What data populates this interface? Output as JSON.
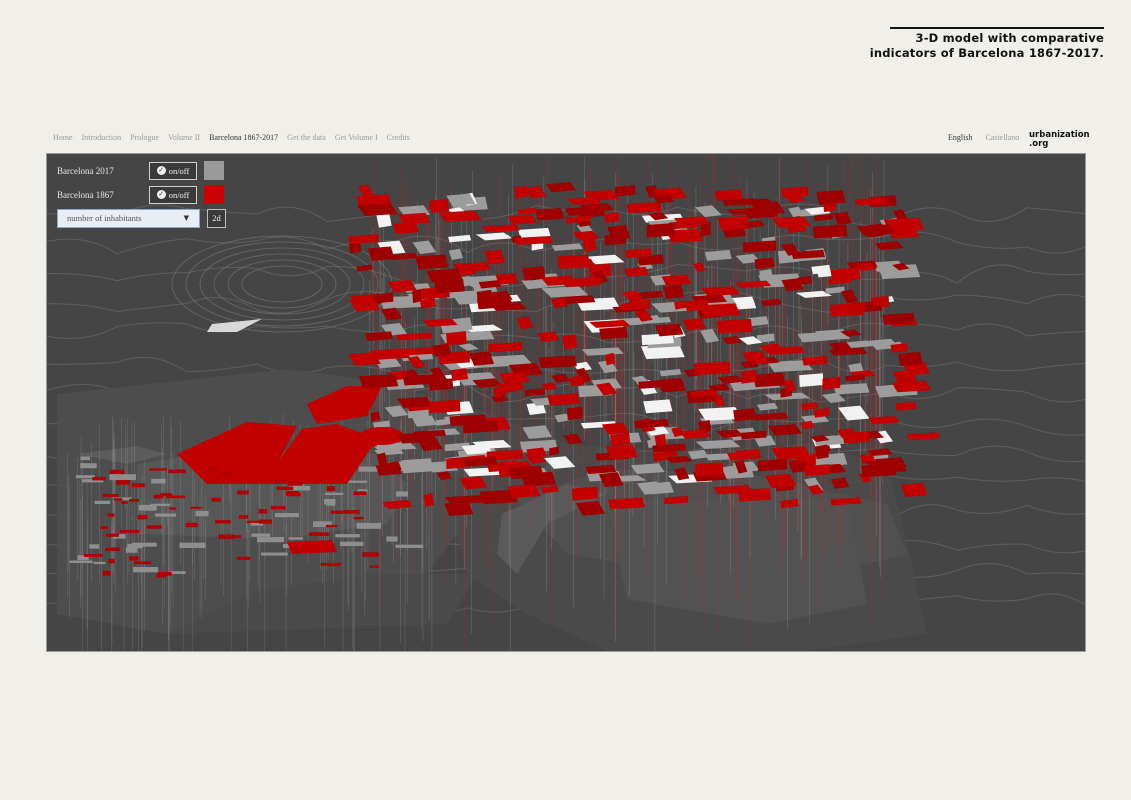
{
  "poster": {
    "title_line1": "3-D model with comparative",
    "title_line2": "indicators of Barcelona 1867-2017."
  },
  "nav": {
    "items": [
      "Home",
      "Introduction",
      "Prologue",
      "Volume II",
      "Barcelona 1867-2017",
      "Get the data",
      "Get Volume I",
      "Credits"
    ],
    "active": "Barcelona 1867-2017"
  },
  "lang": {
    "english": "English",
    "castellano": "Castellano",
    "active": "English"
  },
  "logo": {
    "line1": "urbanization",
    "line2": ".org"
  },
  "controls": {
    "layer_2017": {
      "label": "Barcelona 2017",
      "toggle": "on/off",
      "color": "#9a9a9a"
    },
    "layer_1867": {
      "label": "Barcelona 1867",
      "toggle": "on/off",
      "color": "#cc0000"
    },
    "indicator_select": {
      "value": "number of inhabitants"
    },
    "view_button": "2d"
  },
  "colors": {
    "background": "#f0efea",
    "viewer_bg": "#454545",
    "accent_red": "#cc0000"
  }
}
